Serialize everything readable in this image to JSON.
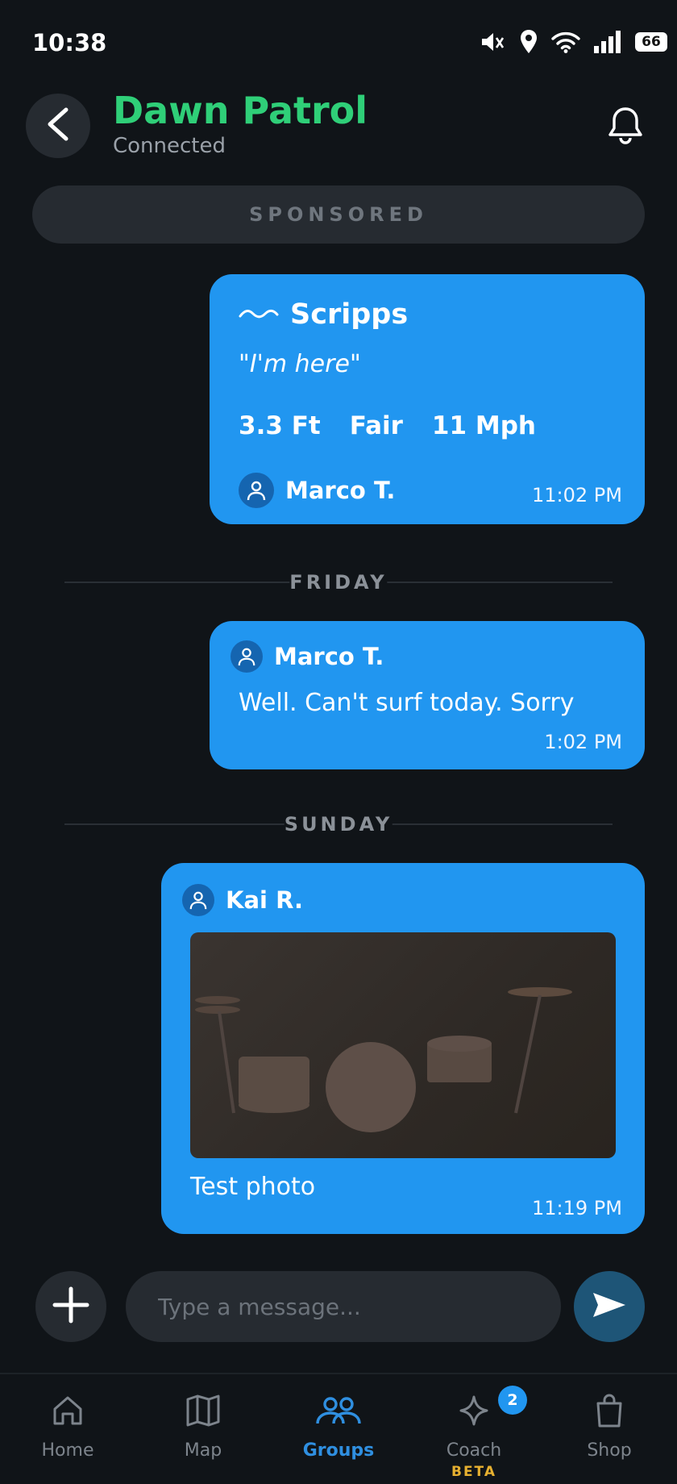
{
  "status_bar": {
    "time": "10:38",
    "battery": "66"
  },
  "header": {
    "title": "Dawn Patrol",
    "subtitle": "Connected"
  },
  "sponsored_label": "SPONSORED",
  "colors": {
    "accent_blue": "#2196f0",
    "title_green": "#2fcf78",
    "background": "#101418",
    "beta_gold": "#e6b030"
  },
  "surf_card": {
    "icon": "wave-icon",
    "spot": "Scripps",
    "quote_open": "\"",
    "quote_text": "I'm here",
    "quote_close": "\"",
    "height": "3.3 Ft",
    "condition": "Fair",
    "wind": "11 Mph",
    "author": "Marco T.",
    "time": "11:02 PM"
  },
  "separators": [
    "FRIDAY",
    "SUNDAY"
  ],
  "messages": [
    {
      "sender": "Marco T.",
      "text": "Well. Can't surf today. Sorry",
      "time": "1:02 PM"
    },
    {
      "sender": "Kai R.",
      "image": "drum-kit-photo",
      "text": "Test photo",
      "time": "11:19 PM"
    }
  ],
  "composer": {
    "placeholder": "Type a message..."
  },
  "nav": [
    {
      "label": "Home",
      "icon": "home-icon"
    },
    {
      "label": "Map",
      "icon": "map-icon"
    },
    {
      "label": "Groups",
      "icon": "groups-icon",
      "active": true
    },
    {
      "label": "Coach",
      "icon": "sparkle-icon",
      "badge": "2",
      "tag": "BETA"
    },
    {
      "label": "Shop",
      "icon": "shopping-bag-icon"
    }
  ]
}
